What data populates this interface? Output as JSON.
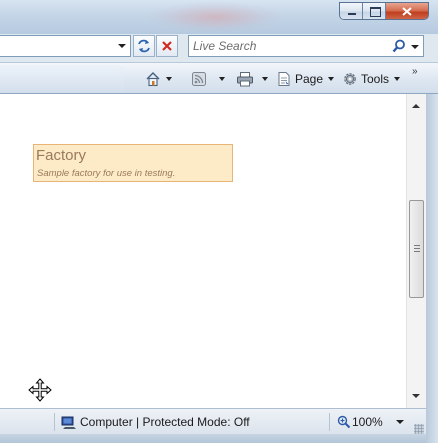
{
  "window": {
    "caption_buttons": [
      "minimize",
      "maximize",
      "close"
    ]
  },
  "address_bar": {
    "url": ""
  },
  "search": {
    "placeholder": "Live Search"
  },
  "command_bar": {
    "page_label": "Page",
    "tools_label": "Tools",
    "more": "»"
  },
  "content": {
    "factory": {
      "title": "Factory",
      "description": "Sample factory for use in testing."
    }
  },
  "status_bar": {
    "zone": "Computer | Protected Mode: Off",
    "zoom": "100%"
  },
  "colors": {
    "card_background": "#fdebc8",
    "card_border": "#e8b576",
    "card_text": "#9b7a57",
    "close_button": "#c0401f"
  }
}
